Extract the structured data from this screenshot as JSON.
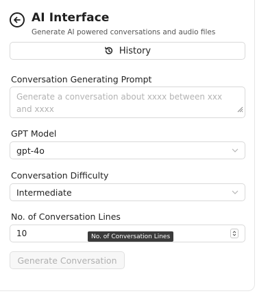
{
  "header": {
    "title": "AI Interface",
    "subtitle": "Generate AI powered conversations and audio files"
  },
  "history_button": {
    "label": "History",
    "icon": "history-icon"
  },
  "prompt": {
    "label": "Conversation Generating Prompt",
    "placeholder": "Generate a conversation about xxxx between xxx and xxxx"
  },
  "model": {
    "label": "GPT Model",
    "selected": "gpt-4o"
  },
  "difficulty": {
    "label": "Conversation Difficulty",
    "selected": "Intermediate"
  },
  "lines": {
    "label": "No. of Conversation Lines",
    "value": "10",
    "tooltip": "No. of Conversation Lines"
  },
  "generate_button": {
    "label": "Generate Conversation",
    "disabled": true
  },
  "colors": {
    "border": "#d9d9d9",
    "placeholder": "#b3b3b3",
    "tooltip_bg": "#3b3b3b",
    "disabled_text": "#b0b0b0"
  }
}
